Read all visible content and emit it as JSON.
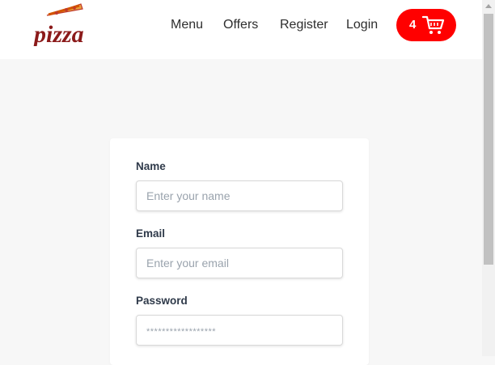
{
  "header": {
    "logo_text": "pizza",
    "nav": [
      {
        "label": "Menu"
      },
      {
        "label": "Offers"
      },
      {
        "label": "Register"
      },
      {
        "label": "Login"
      }
    ],
    "cart": {
      "count": "4",
      "icon": "cart-icon"
    }
  },
  "form": {
    "name": {
      "label": "Name",
      "placeholder": "Enter your name"
    },
    "email": {
      "label": "Email",
      "placeholder": "Enter your email"
    },
    "password": {
      "label": "Password",
      "placeholder": "******************"
    }
  },
  "colors": {
    "brand": "#ff0000",
    "logo_text": "#8b1a1a",
    "page_background": "#f7f7f7"
  }
}
